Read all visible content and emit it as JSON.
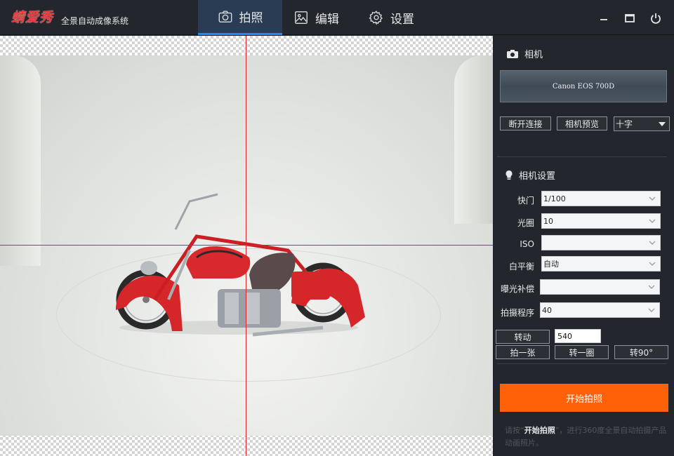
{
  "app": {
    "logo": "蜻爱秀",
    "subtitle": "全景自动成像系统"
  },
  "tabs": [
    {
      "label": "拍照",
      "icon": "camera-icon",
      "active": true
    },
    {
      "label": "编辑",
      "icon": "image-icon",
      "active": false
    },
    {
      "label": "设置",
      "icon": "gear-icon",
      "active": false
    }
  ],
  "window_controls": [
    "minimize-icon",
    "maximize-icon",
    "power-icon"
  ],
  "panel": {
    "camera_section_title": "相机",
    "camera_model": "Canon EOS 700D",
    "disconnect_label": "断开连接",
    "preview_label": "相机预览",
    "overlay_mode": "十字",
    "settings_title": "相机设置",
    "fields": [
      {
        "label": "快门",
        "value": "1/100"
      },
      {
        "label": "光圈",
        "value": "10"
      },
      {
        "label": "ISO",
        "value": ""
      },
      {
        "label": "白平衡",
        "value": "自动"
      },
      {
        "label": "曝光补偿",
        "value": ""
      },
      {
        "label": "拍摄程序",
        "value": "40"
      }
    ],
    "rotate_label": "转动",
    "rotate_value": "540",
    "shoot_one_label": "拍一张",
    "rotate_circle_label": "转一圈",
    "rotate_90_label": "转90°",
    "start_label": "开始拍照",
    "hint_prefix": "请按“",
    "hint_highlight": "开始拍照",
    "hint_suffix": "”，进行360度全景自动拍摄产品动画照片。"
  },
  "colors": {
    "accent": "#1e88ff",
    "start_button": "#ff6108",
    "crosshair": "#d8262b",
    "logo": "#e8373a"
  }
}
